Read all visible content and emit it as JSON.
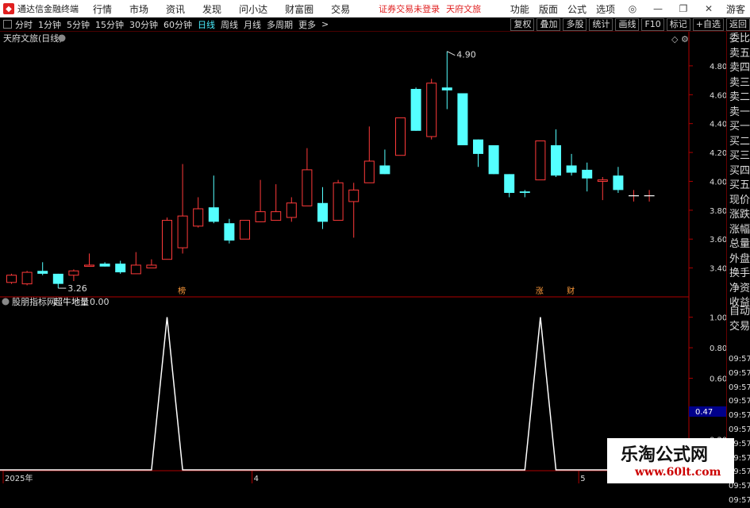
{
  "app": {
    "name": "通达信金融终端",
    "menus": [
      "行情",
      "市场",
      "资讯",
      "发现",
      "问小达",
      "财富圈",
      "交易"
    ],
    "notice": "证券交易未登录",
    "stock_name": "天府文旅",
    "right_menus": [
      "功能",
      "版面",
      "公式",
      "选项"
    ],
    "guest": "游客"
  },
  "toolbar": {
    "periods": [
      "分时",
      "1分钟",
      "5分钟",
      "15分钟",
      "30分钟",
      "60分钟",
      "日线",
      "周线",
      "月线",
      "多周期",
      "更多"
    ],
    "active": "日线",
    "right_buttons": [
      "复权",
      "叠加",
      "多股",
      "统计",
      "画线",
      "F10",
      "标记",
      "+自选",
      "返回"
    ]
  },
  "main_chart": {
    "title": "天府文旅(日线)",
    "high_label": "4.90",
    "low_label": "3.26",
    "y_ticks": [
      "4.80",
      "4.60",
      "4.40",
      "4.20",
      "4.00",
      "3.80",
      "3.60",
      "3.40"
    ],
    "markers": [
      {
        "label": "榜",
        "candle": 11
      },
      {
        "label": "涨",
        "candle": 34
      },
      {
        "label": "财",
        "candle": 36
      }
    ],
    "colors": {
      "up": "#ff3a3a",
      "down": "#54ffff",
      "axis": "#b00000"
    }
  },
  "indicator": {
    "name": "股朋指标网",
    "series_name": "超牛地量",
    "value": "0.00",
    "y_ticks": [
      "1.00",
      "0.80",
      "0.60",
      "0.40",
      "0.20"
    ],
    "current_label": "0.47"
  },
  "x_axis": {
    "labels": [
      {
        "text": "2025年",
        "candle": 0
      },
      {
        "text": "4",
        "candle": 16
      },
      {
        "text": "5",
        "candle": 37
      }
    ]
  },
  "right_panel": {
    "items": [
      "委比",
      "卖五",
      "卖四",
      "卖三",
      "卖二",
      "卖一",
      "买一",
      "买二",
      "买三",
      "买四",
      "买五",
      "现价",
      "涨跌",
      "涨幅",
      "总量",
      "外盘",
      "换手",
      "净资",
      "收益"
    ],
    "section2": [
      "自动",
      "交易"
    ],
    "times": [
      "09:57",
      "09:57",
      "09:57",
      "09:57",
      "09:57",
      "09:57",
      "09:57",
      "09:57",
      "09:57",
      "09:57",
      "09:57"
    ]
  },
  "watermark": {
    "line1": "乐淘公式网",
    "line2": "www.60lt.com"
  },
  "chart_data": {
    "type": "candlestick",
    "candles": [
      {
        "o": 3.3,
        "c": 3.35,
        "h": 3.36,
        "l": 3.29
      },
      {
        "o": 3.29,
        "c": 3.37,
        "h": 3.38,
        "l": 3.28
      },
      {
        "o": 3.38,
        "c": 3.36,
        "h": 3.44,
        "l": 3.35
      },
      {
        "o": 3.36,
        "c": 3.29,
        "h": 3.36,
        "l": 3.26
      },
      {
        "o": 3.35,
        "c": 3.38,
        "h": 3.39,
        "l": 3.31
      },
      {
        "o": 3.42,
        "c": 3.42,
        "h": 3.5,
        "l": 3.41
      },
      {
        "o": 3.43,
        "c": 3.41,
        "h": 3.44,
        "l": 3.41
      },
      {
        "o": 3.43,
        "c": 3.37,
        "h": 3.45,
        "l": 3.36
      },
      {
        "o": 3.36,
        "c": 3.42,
        "h": 3.51,
        "l": 3.36
      },
      {
        "o": 3.4,
        "c": 3.42,
        "h": 3.46,
        "l": 3.4
      },
      {
        "o": 3.46,
        "c": 3.73,
        "h": 3.75,
        "l": 3.46
      },
      {
        "o": 3.54,
        "c": 3.76,
        "h": 4.12,
        "l": 3.5
      },
      {
        "o": 3.69,
        "c": 3.81,
        "h": 3.89,
        "l": 3.68
      },
      {
        "o": 3.82,
        "c": 3.72,
        "h": 4.04,
        "l": 3.71
      },
      {
        "o": 3.71,
        "c": 3.59,
        "h": 3.74,
        "l": 3.57
      },
      {
        "o": 3.6,
        "c": 3.73,
        "h": 3.73,
        "l": 3.6
      },
      {
        "o": 3.72,
        "c": 3.79,
        "h": 4.01,
        "l": 3.72
      },
      {
        "o": 3.73,
        "c": 3.79,
        "h": 3.98,
        "l": 3.73
      },
      {
        "o": 3.75,
        "c": 3.85,
        "h": 3.89,
        "l": 3.72
      },
      {
        "o": 3.83,
        "c": 4.08,
        "h": 4.23,
        "l": 3.83
      },
      {
        "o": 3.85,
        "c": 3.72,
        "h": 3.96,
        "l": 3.67
      },
      {
        "o": 3.73,
        "c": 3.99,
        "h": 4.01,
        "l": 3.73
      },
      {
        "o": 3.86,
        "c": 3.94,
        "h": 3.99,
        "l": 3.61
      },
      {
        "o": 3.99,
        "c": 4.14,
        "h": 4.38,
        "l": 3.99
      },
      {
        "o": 4.11,
        "c": 4.05,
        "h": 4.22,
        "l": 4.05
      },
      {
        "o": 4.18,
        "c": 4.44,
        "h": 4.44,
        "l": 4.18
      },
      {
        "o": 4.64,
        "c": 4.35,
        "h": 4.65,
        "l": 4.35
      },
      {
        "o": 4.31,
        "c": 4.68,
        "h": 4.71,
        "l": 4.29
      },
      {
        "o": 4.65,
        "c": 4.63,
        "h": 4.9,
        "l": 4.5
      },
      {
        "o": 4.61,
        "c": 4.25,
        "h": 4.61,
        "l": 4.25
      },
      {
        "o": 4.29,
        "c": 4.19,
        "h": 4.29,
        "l": 4.1
      },
      {
        "o": 4.25,
        "c": 4.05,
        "h": 4.25,
        "l": 4.05
      },
      {
        "o": 4.05,
        "c": 3.92,
        "h": 4.05,
        "l": 3.89
      },
      {
        "o": 3.93,
        "c": 3.92,
        "h": 3.94,
        "l": 3.89
      },
      {
        "o": 4.01,
        "c": 4.28,
        "h": 4.28,
        "l": 4.01
      },
      {
        "o": 4.25,
        "c": 4.04,
        "h": 4.36,
        "l": 4.03
      },
      {
        "o": 4.11,
        "c": 4.06,
        "h": 4.19,
        "l": 4.04
      },
      {
        "o": 4.08,
        "c": 4.02,
        "h": 4.13,
        "l": 3.93
      },
      {
        "o": 4.0,
        "c": 4.01,
        "h": 4.03,
        "l": 3.87
      },
      {
        "o": 4.04,
        "c": 3.94,
        "h": 4.1,
        "l": 3.92
      },
      {
        "o": 3.9,
        "c": 3.9,
        "h": 3.94,
        "l": 3.86
      },
      {
        "o": 3.9,
        "c": 3.9,
        "h": 3.94,
        "l": 3.86
      }
    ],
    "indicator": [
      0,
      0,
      0,
      0,
      0,
      0,
      0,
      0,
      0,
      0,
      1,
      0,
      0,
      0,
      0,
      0,
      0,
      0,
      0,
      0,
      0,
      0,
      0,
      0,
      0,
      0,
      0,
      0,
      0,
      0,
      0,
      0,
      0,
      0,
      1,
      0,
      0,
      0,
      0,
      0,
      0,
      0
    ],
    "ylim": [
      3.2,
      4.97
    ],
    "ylim_indicator": [
      0,
      1.05
    ]
  }
}
